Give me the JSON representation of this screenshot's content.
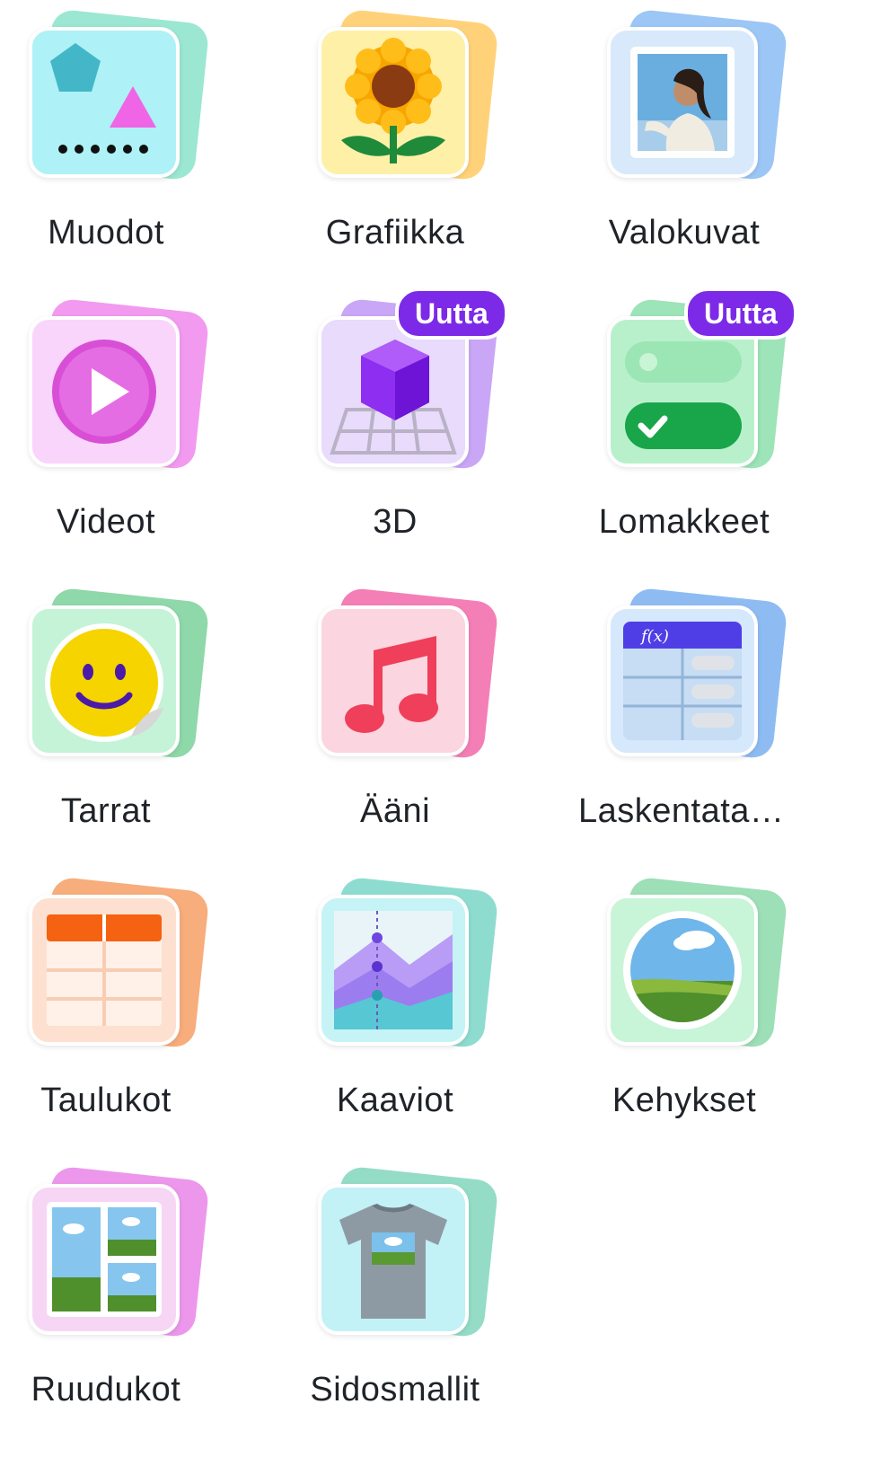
{
  "categories": [
    {
      "label": "Muodot",
      "icon": "shapes-icon"
    },
    {
      "label": "Grafiikka",
      "icon": "sunflower-graphics-icon"
    },
    {
      "label": "Valokuvat",
      "icon": "photo-icon"
    },
    {
      "label": "Videot",
      "icon": "video-play-icon"
    },
    {
      "label": "3D",
      "icon": "3d-cube-icon",
      "badge": "Uutta"
    },
    {
      "label": "Lomakkeet",
      "icon": "form-toggle-icon",
      "badge": "Uutta"
    },
    {
      "label": "Tarrat",
      "icon": "smiley-sticker-icon"
    },
    {
      "label": "Ääni",
      "icon": "music-note-icon"
    },
    {
      "label": "Laskentataul...",
      "icon": "spreadsheet-icon",
      "formula": "f(x)"
    },
    {
      "label": "Taulukot",
      "icon": "table-icon"
    },
    {
      "label": "Kaaviot",
      "icon": "chart-icon"
    },
    {
      "label": "Kehykset",
      "icon": "frame-icon"
    },
    {
      "label": "Ruudukot",
      "icon": "grid-icon"
    },
    {
      "label": "Sidosmallit",
      "icon": "tshirt-mockup-icon"
    }
  ],
  "colors": {
    "badge": "#7c2ae8",
    "label": "#1f2328"
  }
}
